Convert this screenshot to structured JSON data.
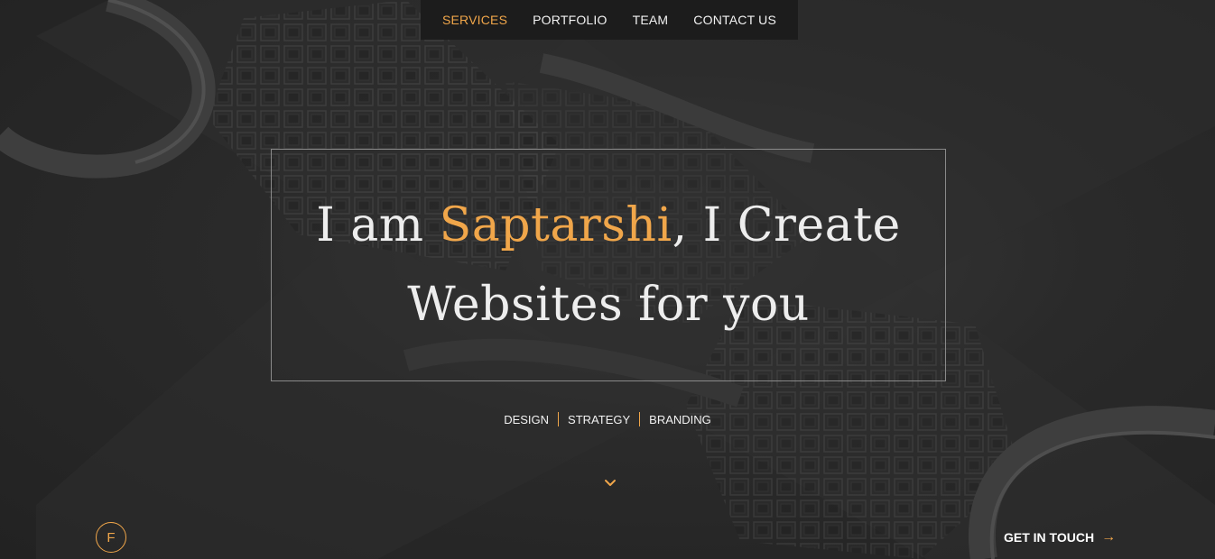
{
  "nav": {
    "items": [
      {
        "label": "SERVICES",
        "active": true
      },
      {
        "label": "PORTFOLIO",
        "active": false
      },
      {
        "label": "TEAM",
        "active": false
      },
      {
        "label": "CONTACT US",
        "active": false
      }
    ]
  },
  "hero": {
    "line1_prefix": "I am ",
    "line1_name": "Saptarshi",
    "line1_suffix": ", I Create",
    "line2": "Websites for you"
  },
  "tags": [
    "DESIGN",
    "STRATEGY",
    "BRANDING"
  ],
  "scroll_icon": "chevron-down-icon",
  "logo": {
    "letter": "F"
  },
  "cta": {
    "label": "GET IN TOUCH",
    "icon": "arrow-right-icon"
  },
  "colors": {
    "accent": "#f0a64a",
    "background": "#262626",
    "text": "#ededed"
  }
}
